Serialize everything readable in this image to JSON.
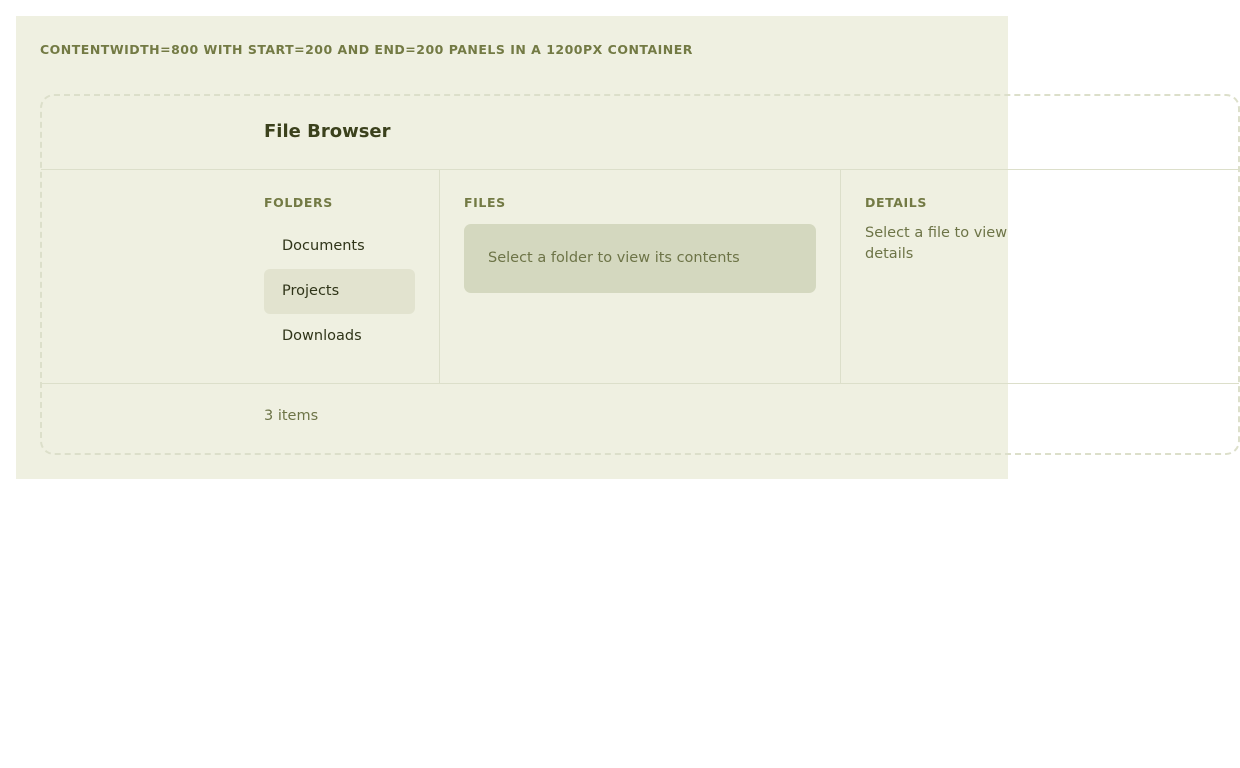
{
  "caption": "CONTENTWIDTH=800 WITH START=200 AND END=200 PANELS IN A 1200PX CONTAINER",
  "header": {
    "title": "File Browser"
  },
  "folders": {
    "label": "FOLDERS",
    "items": [
      {
        "label": "Documents",
        "selected": false
      },
      {
        "label": "Projects",
        "selected": true
      },
      {
        "label": "Downloads",
        "selected": false
      }
    ]
  },
  "files": {
    "label": "FILES",
    "empty_message": "Select a folder to view its contents"
  },
  "details": {
    "label": "DETAILS",
    "empty_message": "Select a file to view details"
  },
  "footer": {
    "status": "3 items"
  },
  "colors": {
    "frame_background": "#eff0e1",
    "selected_item": "#e2e3cf",
    "empty_state": "#d4d8bf",
    "accent_text": "#737a44"
  }
}
